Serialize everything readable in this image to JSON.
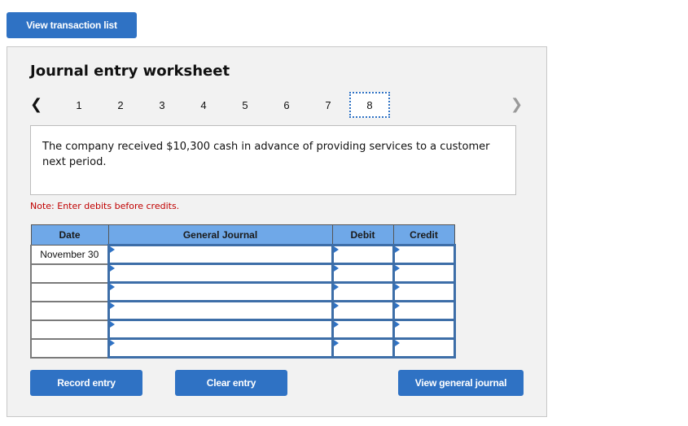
{
  "top_button": {
    "label": "View transaction list"
  },
  "worksheet": {
    "title": "Journal entry worksheet",
    "pager": {
      "prev_icon": "chevron-left-icon",
      "next_icon": "chevron-right-icon",
      "pages": [
        "1",
        "2",
        "3",
        "4",
        "5",
        "6",
        "7",
        "8"
      ],
      "active_page": "8"
    },
    "description": "The company received $10,300 cash in advance of providing services to a customer next period.",
    "note": "Note: Enter debits before credits.",
    "table": {
      "headers": {
        "date": "Date",
        "general_journal": "General Journal",
        "debit": "Debit",
        "credit": "Credit"
      },
      "rows": [
        {
          "date": "November 30",
          "account": "",
          "debit": "",
          "credit": ""
        },
        {
          "date": "",
          "account": "",
          "debit": "",
          "credit": ""
        },
        {
          "date": "",
          "account": "",
          "debit": "",
          "credit": ""
        },
        {
          "date": "",
          "account": "",
          "debit": "",
          "credit": ""
        },
        {
          "date": "",
          "account": "",
          "debit": "",
          "credit": ""
        },
        {
          "date": "",
          "account": "",
          "debit": "",
          "credit": ""
        }
      ]
    },
    "buttons": {
      "record": "Record entry",
      "clear": "Clear entry",
      "view_journal": "View general journal"
    }
  },
  "colors": {
    "button_blue": "#2f72c4",
    "header_blue": "#6fa8e8",
    "note_red": "#c00000",
    "panel_bg": "#f2f2f2"
  }
}
